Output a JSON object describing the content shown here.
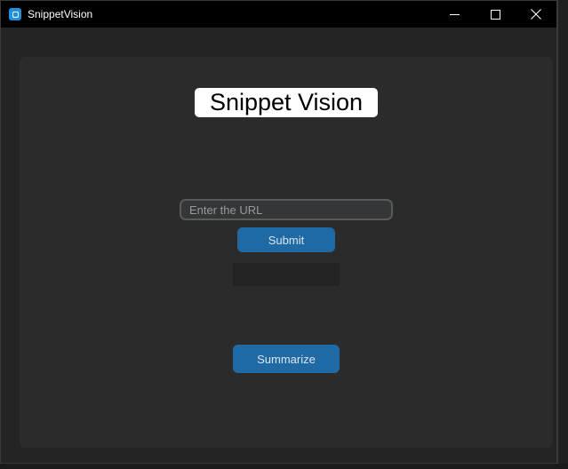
{
  "window": {
    "title": "SnippetVision",
    "controls": {
      "minimize": "minimize-icon",
      "maximize": "maximize-icon",
      "close": "close-icon"
    }
  },
  "main": {
    "heading": "Snippet Vision",
    "url_input": {
      "value": "",
      "placeholder": "Enter the URL"
    },
    "submit_label": "Submit",
    "result_text": "",
    "summarize_label": "Summarize"
  },
  "colors": {
    "accent": "#1f6aa5",
    "panel": "#2b2b2b",
    "background": "#242424",
    "titlebar": "#000000"
  }
}
